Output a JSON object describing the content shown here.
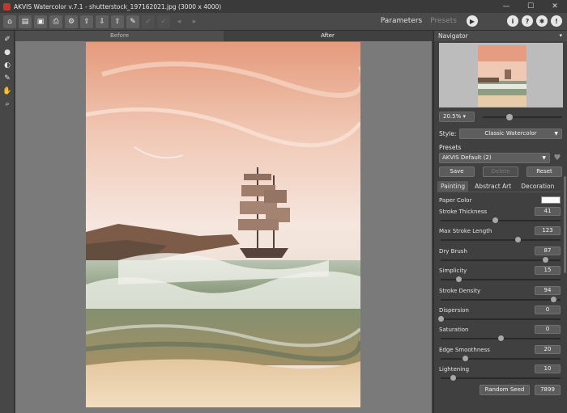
{
  "window": {
    "title": "AKVIS Watercolor v.7.1 - shutterstock_197162021.jpg (3000 x 4000)",
    "controls": [
      "—",
      "☐",
      "✕"
    ]
  },
  "toolbar": {
    "mode_tabs": [
      "Parameters",
      "Presets"
    ],
    "icons": [
      "home-icon",
      "open-icon",
      "save-icon",
      "print-icon",
      "batch-icon",
      "share-icon",
      "import-icon",
      "export-icon",
      "brush-icon",
      "apply-icon",
      "undo-icon",
      "redo-icon",
      "run-icon",
      "info-icon",
      "help-icon",
      "settings-icon",
      "notify-icon"
    ]
  },
  "leftbar": {
    "tools": [
      "pencil-icon",
      "drop-icon",
      "eraser-icon",
      "brush-icon",
      "hand-icon",
      "zoom-icon"
    ]
  },
  "canvas": {
    "before_label": "Before",
    "after_label": "After"
  },
  "navigator": {
    "title": "Navigator",
    "zoom": "20.5%"
  },
  "style": {
    "label": "Style:",
    "value": "Classic Watercolor"
  },
  "presets": {
    "label": "Presets",
    "value": "AKVIS Default (2)",
    "save": "Save",
    "delete": "Delete",
    "reset": "Reset"
  },
  "tabs": [
    "Painting",
    "Abstract Art",
    "Decoration"
  ],
  "params": {
    "paper_color_label": "Paper Color",
    "items": [
      {
        "label": "Stroke Thickness",
        "value": "41",
        "pct": 45
      },
      {
        "label": "Max Stroke Length",
        "value": "123",
        "pct": 64
      },
      {
        "label": "Dry Brush",
        "value": "87",
        "pct": 87
      },
      {
        "label": "Simplicity",
        "value": "15",
        "pct": 15
      },
      {
        "label": "Stroke Density",
        "value": "94",
        "pct": 94
      },
      {
        "label": "Dispersion",
        "value": "0",
        "pct": 0
      },
      {
        "label": "Saturation",
        "value": "0",
        "pct": 50
      },
      {
        "label": "Edge Smoothness",
        "value": "20",
        "pct": 20
      },
      {
        "label": "Lightening",
        "value": "10",
        "pct": 10
      }
    ],
    "seed_label": "Random Seed",
    "seed_value": "7899"
  },
  "colors": {
    "panel_bg": "#404040",
    "canvas_bg": "#7a7a7a",
    "toolbar_bg": "#4a4a4a"
  }
}
